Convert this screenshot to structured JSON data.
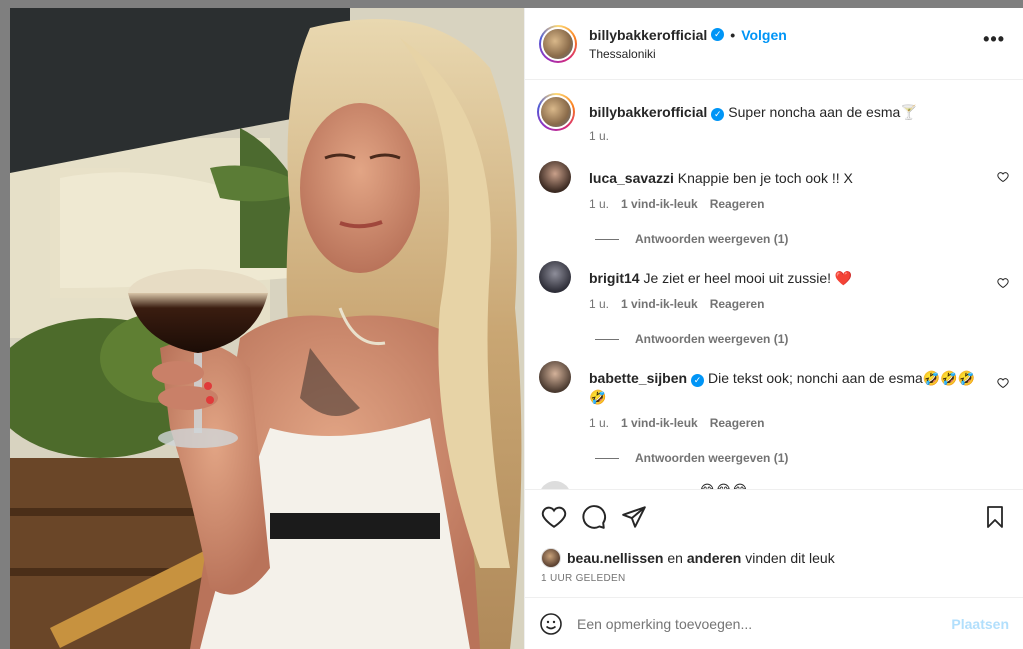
{
  "post": {
    "username": "billybakkerofficial",
    "follow_label": "Volgen",
    "location": "Thessaloniki",
    "more_label": "•••"
  },
  "caption": {
    "username": "billybakkerofficial",
    "text": "Super noncha aan de esma🍸",
    "time": "1 u."
  },
  "comments": [
    {
      "username": "luca_savazzi",
      "text": "Knappie ben je toch ook !! X",
      "time": "1 u.",
      "likes": "1 vind-ik-leuk",
      "reply": "Reageren",
      "view_replies": "Antwoorden weergeven (1)",
      "verified": false
    },
    {
      "username": "brigit14",
      "text": "Je ziet er heel mooi uit zussie! ❤️",
      "time": "1 u.",
      "likes": "1 vind-ik-leuk",
      "reply": "Reageren",
      "view_replies": "Antwoorden weergeven (1)",
      "verified": false
    },
    {
      "username": "babette_sijben",
      "text": "Die tekst ook; nonchi aan de esma🤣🤣🤣🤣",
      "time": "1 u.",
      "likes": "1 vind-ik-leuk",
      "reply": "Reageren",
      "view_replies": "Antwoorden weergeven (1)",
      "verified": true
    }
  ],
  "partial_comment": {
    "text": "😂😂😂"
  },
  "likes": {
    "user": "beau.nellissen",
    "connector": "en",
    "others": "anderen",
    "suffix": "vinden dit leuk"
  },
  "time_ago": "1 UUR GELEDEN",
  "add_comment": {
    "placeholder": "Een opmerking toevoegen...",
    "post_label": "Plaatsen"
  },
  "colors": {
    "accent": "#0095f6",
    "post_disabled": "#b2dffc",
    "secondary_text": "#737373"
  }
}
